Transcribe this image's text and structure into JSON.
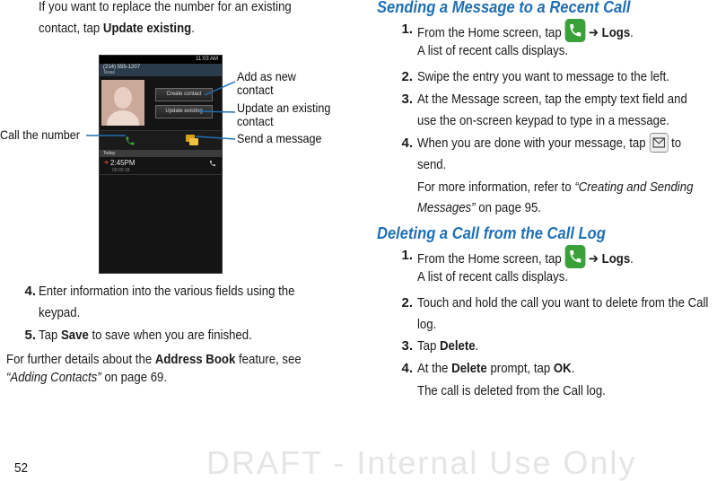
{
  "left": {
    "intro_line1": "If you want to replace the number for an existing",
    "intro_line2_prefix": "contact, tap ",
    "intro_line2_bold": "Update existing",
    "intro_line2_suffix": ".",
    "steps": [
      {
        "num": "4.",
        "line1": "Enter information into the various fields using the",
        "line2": "keypad."
      },
      {
        "num": "5.",
        "prefix": "Tap ",
        "bold": "Save",
        "suffix": " to save when you are finished."
      }
    ],
    "further_prefix": "For further details about the ",
    "further_bold": "Address Book",
    "further_suffix": " feature, see",
    "further_ref": "“Adding Contacts”",
    "further_page": " on page 69."
  },
  "figure": {
    "callouts": {
      "add_new": [
        "Add as new",
        "contact"
      ],
      "update_existing": [
        "Update an existing",
        "contact"
      ],
      "send_message": "Send a message",
      "call_number": "Call the number"
    },
    "phone": {
      "clock": "11:03 AM",
      "number": "(214) 555-1207",
      "city": "Texas",
      "create_contact": "Create contact",
      "update_existing": "Update existing",
      "today": "Today",
      "log_time": "2:45PM",
      "log_duration": "00:00:18"
    }
  },
  "right": {
    "section1": {
      "heading": "Sending a Message to a Recent Call",
      "step1_num": "1.",
      "step1_prefix": "From the Home screen, tap",
      "step1_arrow": "➔",
      "step1_bold": "Logs",
      "step1_suffix": ".",
      "step1_note": "A list of recent calls displays.",
      "step2_num": "2.",
      "step2_text": "Swipe the entry you want to message to the left.",
      "step3_num": "3.",
      "step3_line1": "At the Message screen, tap the empty text field and",
      "step3_line2": "use the on-screen keypad to type in a message.",
      "step4_num": "4.",
      "step4_prefix": "When you are done with your message, tap",
      "step4_suffix": "to",
      "step4_line2": "send.",
      "step4_note_prefix": "For more information, refer to ",
      "step4_note_ref1": "“Creating and Sending",
      "step4_note_ref2": "Messages”",
      "step4_note_suffix": "  on page 95."
    },
    "section2": {
      "heading": "Deleting a Call from the Call Log",
      "step1_num": "1.",
      "step1_prefix": "From the Home screen, tap",
      "step1_arrow": "➔",
      "step1_bold": "Logs",
      "step1_suffix": ".",
      "step1_note": "A list of recent calls displays.",
      "step2_num": "2.",
      "step2_line1": "Touch and hold the call you want to delete from the Call",
      "step2_line2": "log.",
      "step3_num": "3.",
      "step3_prefix": "Tap ",
      "step3_bold": "Delete",
      "step3_suffix": ".",
      "step4_num": "4.",
      "step4_prefix": "At the ",
      "step4_bold1": "Delete",
      "step4_mid": " prompt, tap ",
      "step4_bold2": "OK",
      "step4_suffix": ".",
      "step4_note": "The call is deleted from the Call log."
    }
  },
  "footer": {
    "page_number": "52",
    "watermark": "DRAFT - Internal Use Only"
  },
  "colors": {
    "heading": "#1f6fb5",
    "phone_green": "#3aa13a"
  },
  "icons": {
    "phone_app": "phone-icon",
    "send": "envelope-send-icon"
  }
}
